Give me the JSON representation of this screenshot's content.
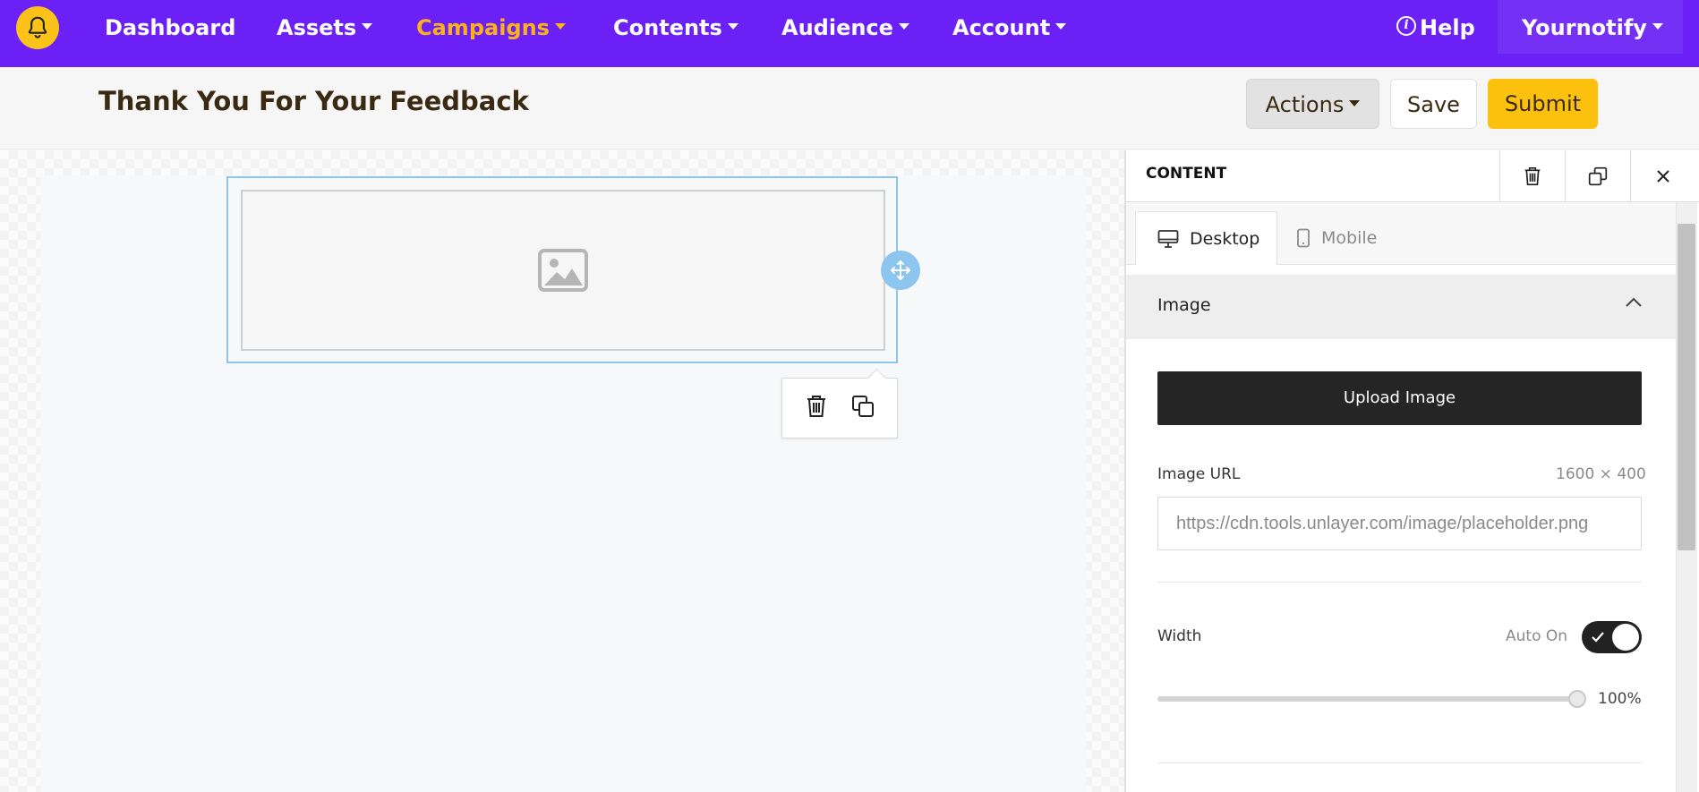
{
  "nav": {
    "items": [
      {
        "label": "Dashboard",
        "has_caret": false
      },
      {
        "label": "Assets",
        "has_caret": true
      },
      {
        "label": "Campaigns",
        "has_caret": true,
        "active": true
      },
      {
        "label": "Contents",
        "has_caret": true
      },
      {
        "label": "Audience",
        "has_caret": true
      },
      {
        "label": "Account",
        "has_caret": true
      }
    ],
    "help_label": "Help",
    "user_label": "Yournotify",
    "icons": {
      "logo": "bell-icon",
      "help": "info-icon"
    },
    "colors": {
      "bar": "#6b21f5",
      "active": "#fbb21a",
      "logo": "#fbc21a"
    }
  },
  "header": {
    "title": "Thank You For Your Feedback",
    "actions_label": "Actions",
    "save_label": "Save",
    "submit_label": "Submit",
    "submit_color": "#fcc10f"
  },
  "canvas": {
    "image_icon": "image-icon",
    "move_icon": "move-icon",
    "toolbar_icons": [
      "trash-icon",
      "duplicate-icon"
    ]
  },
  "panel": {
    "title": "CONTENT",
    "head_icons": [
      "trash-icon",
      "duplicate-icon",
      "close-icon"
    ],
    "tabs": [
      {
        "label": "Desktop",
        "icon": "desktop-icon",
        "active": true
      },
      {
        "label": "Mobile",
        "icon": "mobile-icon",
        "active": false
      }
    ],
    "section_title": "Image",
    "upload_label": "Upload Image",
    "image_url_label": "Image URL",
    "image_dimensions": "1600 × 400",
    "image_url_value": "https://cdn.tools.unlayer.com/image/placeholder.png",
    "width_label": "Width",
    "auto_label": "Auto On",
    "auto_on": true,
    "width_value": "100%"
  }
}
